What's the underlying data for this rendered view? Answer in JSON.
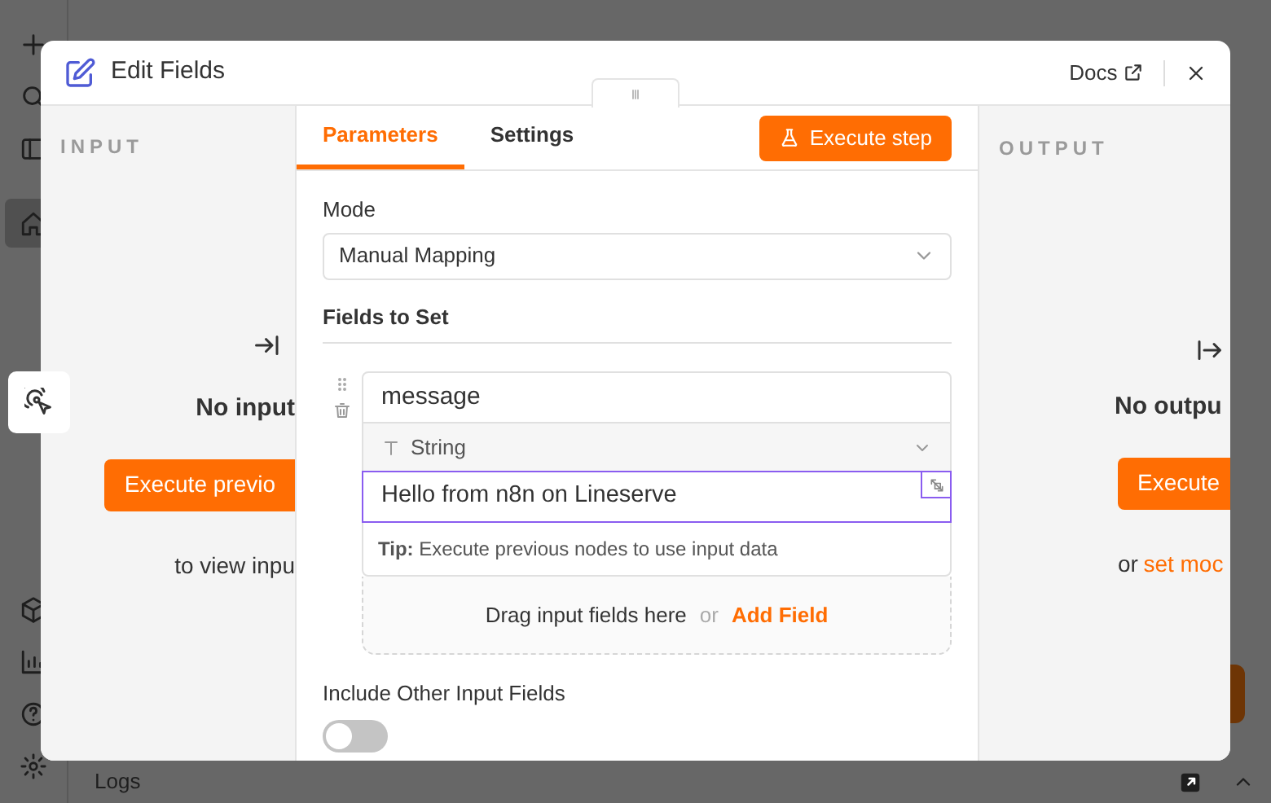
{
  "sidebar": {
    "items": [
      {
        "kind": "add",
        "selected": false
      },
      {
        "kind": "search",
        "selected": false
      },
      {
        "kind": "panel",
        "selected": false
      },
      {
        "kind": "home",
        "selected": true
      },
      {
        "kind": "cube",
        "selected": false
      },
      {
        "kind": "chart",
        "selected": false
      },
      {
        "kind": "help",
        "selected": false
      },
      {
        "kind": "gear",
        "selected": false
      }
    ]
  },
  "modal": {
    "title": "Edit Fields",
    "docs": "Docs"
  },
  "input_panel": {
    "heading": "INPUT",
    "message": "No input",
    "button": "Execute previo",
    "hint": "to view inpu"
  },
  "parameters": {
    "tabs": [
      {
        "label": "Parameters",
        "selected": true
      },
      {
        "label": "Settings",
        "selected": false
      }
    ],
    "execute_button": "Execute step",
    "mode": {
      "label": "Mode",
      "value": "Manual Mapping"
    },
    "fields_to_set": {
      "label": "Fields to Set",
      "fields": [
        {
          "name": "message",
          "type": "String",
          "value": "Hello from n8n on Lineserve",
          "focused": true,
          "tip": "**Tip:** Execute previous nodes to use input data"
        }
      ],
      "drop_text": "Drag input fields here",
      "or": "or",
      "add_field": "Add Field"
    },
    "include_other": {
      "label": "Include Other Input Fields",
      "on": false
    }
  },
  "output_panel": {
    "heading": "OUTPUT",
    "message": "No outpu",
    "button": "Execute",
    "or": "or",
    "link": "set moc"
  },
  "logs": {
    "label": "Logs"
  }
}
